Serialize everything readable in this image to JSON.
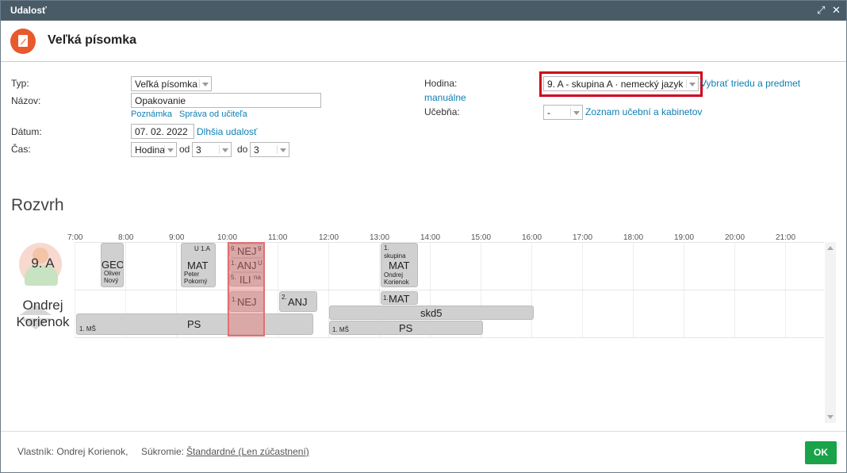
{
  "window": {
    "title": "Udalosť",
    "expand_icon": "expand-icon",
    "close_icon": "close-icon"
  },
  "header": {
    "title": "Veľká písomka",
    "icon": "edit-event-icon",
    "icon_color": "#e8592c"
  },
  "form": {
    "type_label": "Typ:",
    "type_value": "Veľká písomka",
    "name_label": "Názov:",
    "name_value": "Opakovanie",
    "note_link": "Poznámka",
    "teacher_msg_link": "Správa od učiteľa",
    "date_label": "Dátum:",
    "date_value": "07. 02. 2022",
    "longer_event_link": "Dlhšia udalosť",
    "time_label": "Čas:",
    "time_unit_value": "Hodina",
    "from_label": "od",
    "from_value": "3",
    "to_label": "do",
    "to_value": "3",
    "lesson_label": "Hodina:",
    "lesson_value": "9. A - skupina A · nemecký jazyk",
    "manual_link_part1": "Vybrať triedu a predmet",
    "manual_link_part2": "manuálne",
    "room_label": "Učebňa:",
    "room_value": "-",
    "room_list_link": "Zoznam učební a kabinetov"
  },
  "schedule": {
    "title": "Rozvrh",
    "hours": [
      "7:00",
      "8:00",
      "9:00",
      "10:00",
      "11:00",
      "12:00",
      "13:00",
      "14:00",
      "15:00",
      "16:00",
      "17:00",
      "18:00",
      "19:00",
      "20:00",
      "21:00"
    ],
    "rows": [
      {
        "label": "9. A"
      },
      {
        "label_line1": "Ondrej",
        "label_line2": "Korienok"
      }
    ],
    "blocks": {
      "geo": {
        "title": "GEO",
        "sub1": "Oliver",
        "sub2": "Nový"
      },
      "mat1": {
        "room": "U 1.A",
        "title": "MAT",
        "sub1": "Peter",
        "sub2": "Pokorný"
      },
      "nej1": {
        "title": "NEJ",
        "pre": "9.",
        "post": "9"
      },
      "anj1": {
        "title": "ANJ",
        "pre": "1.",
        "post": "U"
      },
      "ili": {
        "title": "ILI",
        "pre": "5.",
        "post": "na"
      },
      "mat2": {
        "pre": "1.",
        "sub0": "skupina",
        "title": "MAT",
        "sub1": "Ondrej",
        "sub2": "Korienok"
      },
      "nej2": {
        "title": "NEJ",
        "pre": "1."
      },
      "anj2": {
        "title": "ANJ",
        "pre": "2."
      },
      "mat3": {
        "title": "MAT",
        "pre": "1."
      },
      "skd5": {
        "title": "skd5"
      },
      "ps1": {
        "title": "PS",
        "tag": "1. MŠ"
      },
      "ps2": {
        "title": "PS",
        "tag": "1. MŠ"
      }
    }
  },
  "footer": {
    "owner": "Vlastník: Ondrej Korienok,",
    "privacy_label": "Súkromie:",
    "privacy_value": "Štandardné (Len zúčastnení)",
    "ok_label": "OK",
    "ok_color": "#1aa34a"
  }
}
